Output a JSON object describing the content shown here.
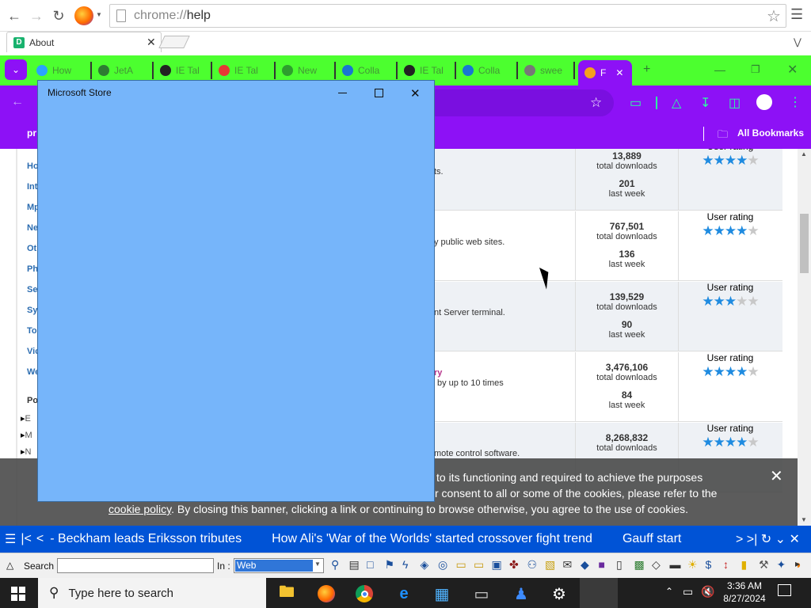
{
  "outer_browser": {
    "url_scheme": "chrome://",
    "url_path": "help",
    "tab_title": "About",
    "tab_icon_letter": "D"
  },
  "inner_browser": {
    "tabs": [
      {
        "label": "How",
        "icon": "blue-page-icon",
        "color": "#2aa3ff"
      },
      {
        "label": "JetA",
        "icon": "jet-icon",
        "color": "#2e7d32"
      },
      {
        "label": "IE Tal",
        "icon": "ie-tab-icon",
        "color": "#222222"
      },
      {
        "label": "IE Tal",
        "icon": "rainbow-icon",
        "color": "#e53935"
      },
      {
        "label": "New",
        "icon": "green-circle-icon",
        "color": "#2e9e2e"
      },
      {
        "label": "Colla",
        "icon": "magnifier-icon",
        "color": "#1976d2"
      },
      {
        "label": "IE Tal",
        "icon": "ie-tab-icon",
        "color": "#222222"
      },
      {
        "label": "Colla",
        "icon": "magnifier-icon",
        "color": "#1976d2"
      },
      {
        "label": "swee",
        "icon": "face-icon",
        "color": "#777777"
      }
    ],
    "active_tab_label": "F",
    "bookmarks_left": "pr",
    "bookmarks_right": "All Bookmarks"
  },
  "page": {
    "left_nav": [
      "Ho",
      "Int",
      "Mp",
      "Ne",
      "Oth",
      "Ph",
      "Se",
      "Sy",
      "To",
      "Vic",
      "We"
    ],
    "popular_heading": "Pop",
    "popular_items": [
      "E",
      "M",
      "N"
    ],
    "rows": [
      {
        "desc": "ts.",
        "link": "",
        "total": "13,889",
        "week": "201",
        "stars": 4
      },
      {
        "desc": "y public web sites.",
        "link": "",
        "total": "767,501",
        "week": "136",
        "stars": 4
      },
      {
        "desc": "nt Server terminal.",
        "link": "",
        "total": "139,529",
        "week": "90",
        "stars": 3
      },
      {
        "desc": "by up to 10 times",
        "link": "ry",
        "total": "3,476,106",
        "week": "84",
        "stars": 4
      },
      {
        "desc": "mote control software.",
        "link": "",
        "total": "8,268,832",
        "week": "",
        "stars": 4
      }
    ],
    "total_downloads_label": "total downloads",
    "last_week_label": "last week",
    "user_rating_label": "User rating"
  },
  "cookie_banner": {
    "line1": "to its functioning and required to achieve the purposes",
    "line2": "r consent to all or some of the cookies, please refer to the",
    "line3_link": "cookie policy",
    "line3_rest": ". By closing this banner, clicking a link or continuing to browse otherwise, you agree to the use of cookies."
  },
  "store_window": {
    "title": "Microsoft Store"
  },
  "ticker": {
    "items": [
      "- Beckham leads Eriksson tributes",
      "How Ali's 'War of the Worlds' started crossover fight trend",
      "Gauff start"
    ]
  },
  "ie_toolbar": {
    "search_label": "Search :",
    "in_label": "In :",
    "in_value": "Web"
  },
  "taskbar": {
    "search_placeholder": "Type here to search",
    "time": "3:36 AM",
    "date": "8/27/2024"
  }
}
